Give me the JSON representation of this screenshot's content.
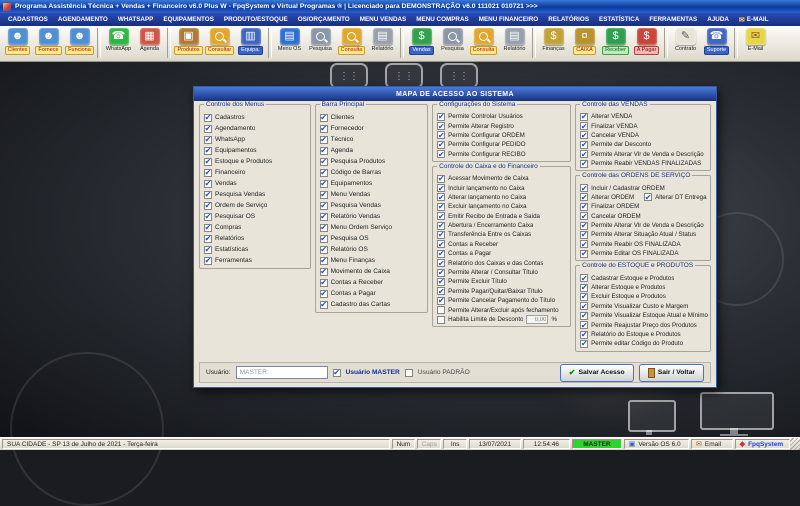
{
  "window": {
    "title": "Programa Assistência Técnica + Vendas + Financeiro v6.0 Plus W  - FpqSystem e Virtual Programas ®  | Licenciado para  DEMONSTRAÇÃO v6.0 111021 010721 >>>"
  },
  "menu": {
    "items": [
      {
        "label": "CADASTROS"
      },
      {
        "label": "AGENDAMENTO"
      },
      {
        "label": "WHATSAPP"
      },
      {
        "label": "EQUIPAMENTOS"
      },
      {
        "label": "PRODUTO/ESTOQUE"
      },
      {
        "label": "OS/ORÇAMENTO"
      },
      {
        "label": "MENU VENDAS"
      },
      {
        "label": "MENU COMPRAS"
      },
      {
        "label": "MENU FINANCEIRO"
      },
      {
        "label": "RELATÓRIOS"
      },
      {
        "label": "ESTATÍSTICA"
      },
      {
        "label": "FERRAMENTAS"
      },
      {
        "label": "AJUDA"
      },
      {
        "label": "E-MAIL",
        "icon": "✉"
      }
    ]
  },
  "toolbar": {
    "items": [
      {
        "label": "Clientes",
        "icon": "clients-icon",
        "bg": "#4f8fd4",
        "glyph": "☻",
        "chip": "yellow"
      },
      {
        "label": "Fornece",
        "icon": "suppliers-icon",
        "bg": "#4f8fd4",
        "glyph": "☻",
        "chip": "yellow"
      },
      {
        "label": "Funciona",
        "icon": "employees-icon",
        "bg": "#4f8fd4",
        "glyph": "☻",
        "chip": "yellow"
      },
      {
        "sep": true
      },
      {
        "label": "WhatsApp",
        "icon": "whatsapp-icon",
        "bg": "#2bb741",
        "glyph": "☎",
        "chip": "plain"
      },
      {
        "label": "Agenda",
        "icon": "calendar-icon",
        "bg": "#d05546",
        "glyph": "▦",
        "chip": "plain"
      },
      {
        "sep": true
      },
      {
        "label": "Produtos",
        "icon": "products-icon",
        "bg": "#b07a35",
        "glyph": "▣",
        "chip": "yellow"
      },
      {
        "label": "Consultar",
        "icon": "search-products-icon",
        "bg": "#e0a72e",
        "mag": true,
        "chip": "yellow"
      },
      {
        "label": "Equipa.",
        "icon": "equipment-icon",
        "bg": "#3f66c2",
        "glyph": "▥",
        "chip": "blue"
      },
      {
        "sep": true
      },
      {
        "label": "Menu OS",
        "icon": "service-orders-icon",
        "bg": "#2f6fd0",
        "glyph": "▤",
        "chip": "plain"
      },
      {
        "label": "Pesquisa",
        "icon": "search-os-icon",
        "bg": "#8a97a8",
        "mag": true,
        "chip": "plain"
      },
      {
        "label": "Consulta",
        "icon": "consult-os-icon",
        "bg": "#e0a72e",
        "mag": true,
        "chip": "yellow"
      },
      {
        "label": "Relatório",
        "icon": "report-os-icon",
        "bg": "#97a0ab",
        "glyph": "▤",
        "chip": "plain"
      },
      {
        "sep": true
      },
      {
        "label": "Vendas",
        "icon": "sales-icon",
        "bg": "#33a04c",
        "glyph": "$",
        "chip": "blue"
      },
      {
        "label": "Pesquisa",
        "icon": "search-sales-icon",
        "bg": "#8a97a8",
        "mag": true,
        "chip": "plain"
      },
      {
        "label": "Consulta",
        "icon": "consult-sales-icon",
        "bg": "#e0a72e",
        "mag": true,
        "chip": "yellow"
      },
      {
        "label": "Relatório",
        "icon": "report-sales-icon",
        "bg": "#97a0ab",
        "glyph": "▤",
        "chip": "plain"
      },
      {
        "sep": true
      },
      {
        "label": "Finanças",
        "icon": "finance-icon",
        "bg": "#c2a339",
        "glyph": "$",
        "chip": "plain"
      },
      {
        "label": "CAIXA",
        "icon": "cash-register-icon",
        "bg": "#b8922b",
        "glyph": "¤",
        "chip": "yellow"
      },
      {
        "label": "Receber",
        "icon": "receivables-icon",
        "bg": "#2f9e4e",
        "glyph": "$",
        "chip": "green"
      },
      {
        "label": "A Pagar",
        "icon": "payables-icon",
        "bg": "#cc4438",
        "glyph": "$",
        "chip": "red"
      },
      {
        "sep": true
      },
      {
        "label": "Contrato",
        "icon": "contract-icon",
        "bg": "#e8e4d8",
        "glyph": "✎",
        "fg": "#555555",
        "chip": "plain"
      },
      {
        "label": "Suporte",
        "icon": "support-icon",
        "bg": "#3f66c2",
        "glyph": "☎",
        "chip": "blue"
      },
      {
        "sep": true
      },
      {
        "label": "E-Mail",
        "icon": "email-icon",
        "bg": "#e8d44a",
        "glyph": "✉",
        "fg": "#8a5a1a",
        "chip": "plain"
      }
    ]
  },
  "dialog": {
    "title": "MAPA DE ACESSO AO SISTEMA",
    "groups": {
      "menus": {
        "title": "Controle dos Menus",
        "items": [
          {
            "label": "Cadastros",
            "checked": true
          },
          {
            "label": "Agendamento",
            "checked": true
          },
          {
            "label": "WhatsApp",
            "checked": true
          },
          {
            "label": "Equipamentos",
            "checked": true
          },
          {
            "label": "Estoque e Produtos",
            "checked": true
          },
          {
            "label": "Financeiro",
            "checked": true
          },
          {
            "label": "Vendas",
            "checked": true
          },
          {
            "label": "Pesquisa Vendas",
            "checked": true
          },
          {
            "label": "Ordem de Serviço",
            "checked": true
          },
          {
            "label": "Pesquisar OS",
            "checked": true
          },
          {
            "label": "Compras",
            "checked": true
          },
          {
            "label": "Relatórios",
            "checked": true
          },
          {
            "label": "Estatísticas",
            "checked": true
          },
          {
            "label": "Ferramentas",
            "checked": true
          }
        ]
      },
      "barra": {
        "title": "Barra Principal",
        "items": [
          {
            "label": "Clientes",
            "checked": true
          },
          {
            "label": "Fornecedor",
            "checked": true
          },
          {
            "label": "Técnico",
            "checked": true
          },
          {
            "label": "Agenda",
            "checked": true
          },
          {
            "label": "Pesquisa Produtos",
            "checked": true
          },
          {
            "label": "Código de Barras",
            "checked": true
          },
          {
            "label": "Equipamentos",
            "checked": true
          },
          {
            "label": "Menu Vendas",
            "checked": true
          },
          {
            "label": "Pesquisa Vendas",
            "checked": true
          },
          {
            "label": "Relatório Vendas",
            "checked": true
          },
          {
            "label": "Menu Ordem Serviço",
            "checked": true
          },
          {
            "label": "Pesquisa OS",
            "checked": true
          },
          {
            "label": "Relatório OS",
            "checked": true
          },
          {
            "label": "Menu Finanças",
            "checked": true
          },
          {
            "label": "Movimento de Caixa",
            "checked": true
          },
          {
            "label": "Contas a Receber",
            "checked": true
          },
          {
            "label": "Contas a Pagar",
            "checked": true
          },
          {
            "label": "Cadastro das Cartas",
            "checked": true
          }
        ]
      },
      "config": {
        "title": "Configurações do Sistema",
        "items": [
          {
            "label": "Permite Controlar Usuários",
            "checked": true
          },
          {
            "label": "Permite Alterar Registro",
            "checked": true
          },
          {
            "label": "Permite Configurar ORDEM",
            "checked": true
          },
          {
            "label": "Permite Configurar PEDIDO",
            "checked": true
          },
          {
            "label": "Permite Configurar RECIBO",
            "checked": true
          }
        ]
      },
      "caixa": {
        "title": "Controle do Caixa e do Financeiro",
        "items": [
          {
            "label": "Acessar Movimento de Caixa",
            "checked": true
          },
          {
            "label": "Incluir lançamento no Caixa",
            "checked": true
          },
          {
            "label": "Alterar lançamento no Caixa",
            "checked": true
          },
          {
            "label": "Excluir lançamento no Caixa",
            "checked": true
          },
          {
            "label": "Emitir Recibo de Entrada e Saída",
            "checked": true
          },
          {
            "label": "Abertura / Encerramento Caixa",
            "checked": true
          },
          {
            "label": "Transferência Entre os Caixas",
            "checked": true
          },
          {
            "label": "Contas a Receber",
            "checked": true
          },
          {
            "label": "Contas a Pagar",
            "checked": true
          },
          {
            "label": "Relatório dos Caixas e das Contas",
            "checked": true
          },
          {
            "label": "Permite Alterar / Consultar Título",
            "checked": true
          },
          {
            "label": "Permite Excluir Título",
            "checked": true
          },
          {
            "label": "Permite Pagar/Quitar/Baixar Título",
            "checked": true
          },
          {
            "label": "Permite Cancelar Pagamento do Título",
            "checked": true
          },
          {
            "label": "Permite Alterar/Excluir após fechamento",
            "checked": false
          },
          {
            "label": "Habilita Limite de Desconto",
            "checked": false,
            "input": "0,00",
            "suffix": "%"
          }
        ]
      },
      "vendas": {
        "title": "Controle das VENDAS",
        "items": [
          {
            "label": "Alterar VENDA",
            "checked": true
          },
          {
            "label": "Finalizar VENDA",
            "checked": true
          },
          {
            "label": "Cancelar VENDA",
            "checked": true
          },
          {
            "label": "Permite dar Desconto",
            "checked": true
          },
          {
            "label": "Permite Alterar Vlr de Venda e Descrição",
            "checked": true
          },
          {
            "label": "Permite Reabir VENDAS FINALIZADAS",
            "checked": true
          }
        ]
      },
      "ordens": {
        "title": "Controle das ORDENS DE SERVIÇO",
        "items": [
          {
            "label": "Incluir / Cadastrar ORDEM",
            "checked": true
          },
          {
            "label": "Alterar ORDEM",
            "checked": true,
            "half": true
          },
          {
            "label": "Alterar DT Entrega",
            "checked": true,
            "half": true
          },
          {
            "label": "Finalizar ORDEM",
            "checked": true
          },
          {
            "label": "Cancelar ORDEM",
            "checked": true
          },
          {
            "label": "Permite Alterar Vlr de Venda e Descrição",
            "checked": true
          },
          {
            "label": "Permite Alterar Situação Atual / Status",
            "checked": true
          },
          {
            "label": "Permite Reabir OS FINALIZADA",
            "checked": true
          },
          {
            "label": "Permite Editar OS FINALIZADA",
            "checked": true
          }
        ]
      },
      "estoque": {
        "title": "Controle do ESTOQUE e PRODUTOS",
        "items": [
          {
            "label": "Cadastrar Estoque e Produtos",
            "checked": true
          },
          {
            "label": "Alterar Estoque e Produtos",
            "checked": true
          },
          {
            "label": "Excluir Estoque e Produtos",
            "checked": true
          },
          {
            "label": "Permite Visualizar Custo e Margem",
            "checked": true
          },
          {
            "label": "Permite Visualizar Estoque Atual e Mínimo",
            "checked": true
          },
          {
            "label": "Permite Reajustar Preço dos Produtos",
            "checked": true
          },
          {
            "label": "Relatório do Estoque e Produtos",
            "checked": true
          },
          {
            "label": "Permite editar Código do Produto",
            "checked": true
          }
        ]
      }
    },
    "footer": {
      "user_label": "Usuário:",
      "user_value": "MASTER",
      "master_label": "Usuário MASTER",
      "padrao_label": "Usuário PADRÃO",
      "save_label": "Salvar Acesso",
      "exit_label": "Sair / Voltar"
    }
  },
  "statusbar": {
    "location": "SUA CIDADE - SP 13 de Julho de 2021  - Terça-feira",
    "num": "Num",
    "caps": "Caps",
    "ins": "Ins",
    "date": "13/07/2021",
    "time": "12:54:46",
    "user": "MASTER",
    "version": "Versão OS 6.0",
    "email": "Email",
    "brand": "FpqSystem"
  },
  "colors": {
    "titlebar_blue": "#0b3a9e",
    "menubar_blue": "#16307e",
    "dialog_bg": "#e8e4da",
    "check_blue": "#2050c8",
    "status_user_green": "#2fd32f"
  }
}
